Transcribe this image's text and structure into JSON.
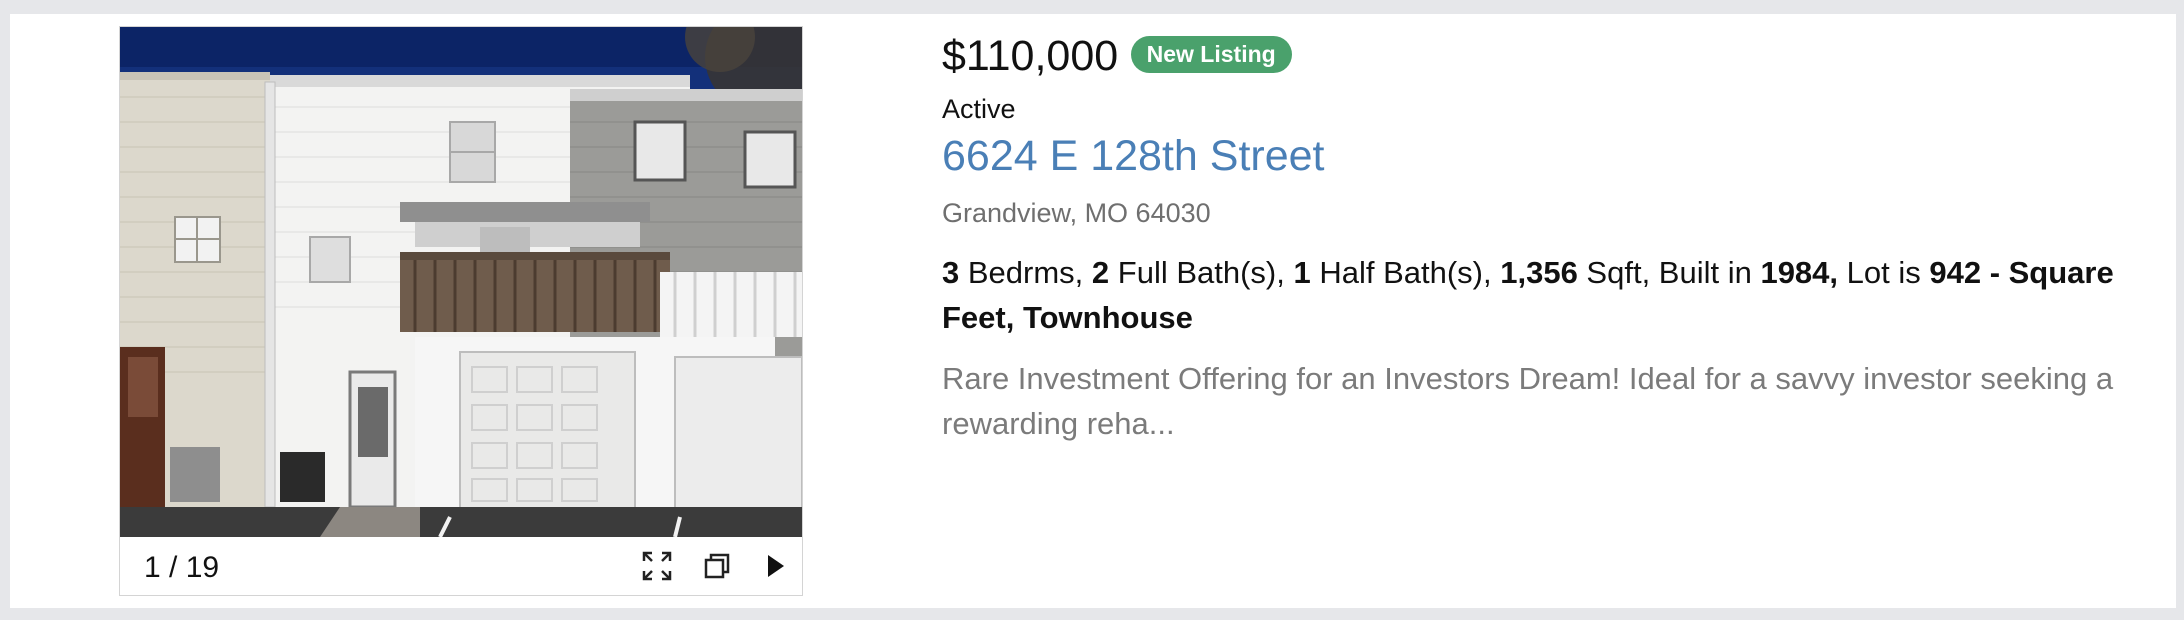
{
  "photo": {
    "counter": "1 / 19",
    "controls": [
      "fullscreen-icon",
      "popout-icon",
      "next-arrow-icon"
    ]
  },
  "listing": {
    "price": "$110,000",
    "badge": "New Listing",
    "status": "Active",
    "address": "6624 E 128th Street",
    "city_line": "Grandview, MO 64030",
    "details": {
      "beds": "3",
      "beds_label": " Bedrms, ",
      "full_baths": "2",
      "full_baths_label": " Full Bath(s), ",
      "half_baths": "1",
      "half_baths_label": " Half Bath(s), ",
      "sqft": "1,356",
      "sqft_label": " Sqft, Built in ",
      "year_built": "1984,",
      "lot_label": " Lot is ",
      "lot": "942 - Square Feet, Townhouse"
    },
    "description": "Rare Investment Offering for an Investors Dream! Ideal for a savvy investor seeking a rewarding reha..."
  },
  "colors": {
    "badge": "#4aa16c",
    "address_link": "#4a7fb6",
    "background": "#e6e7ea"
  }
}
